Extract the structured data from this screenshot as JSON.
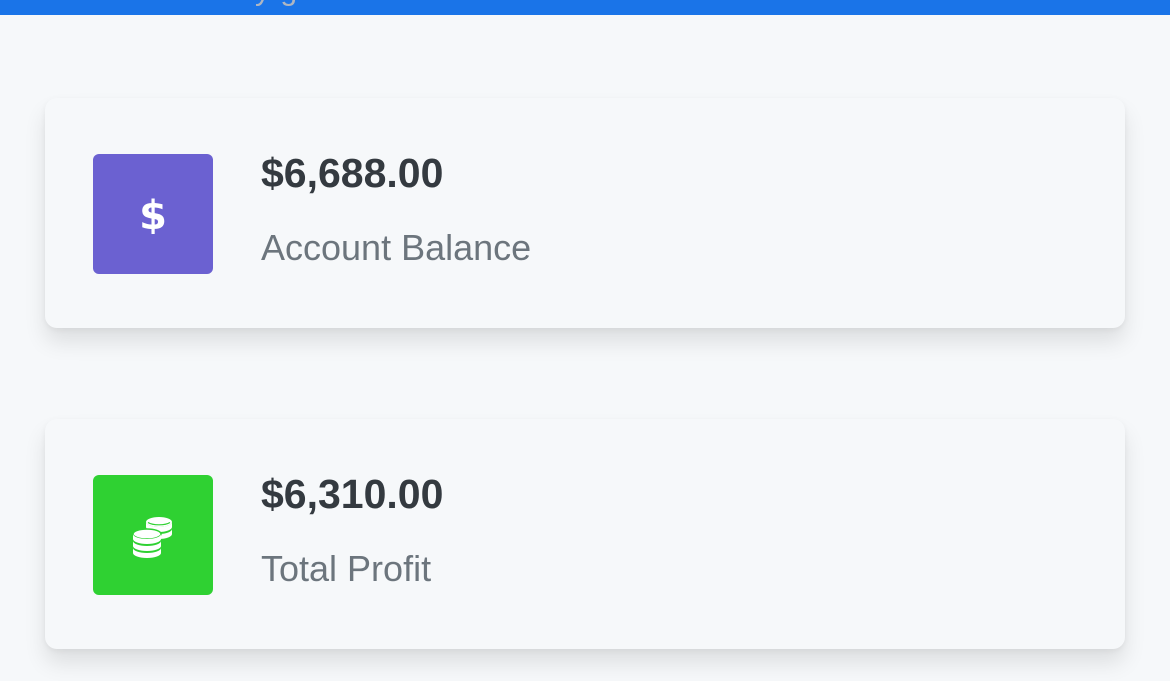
{
  "header": {
    "bar_color": "#1a74e8",
    "partial_heading": "y       g"
  },
  "cards": [
    {
      "value": "$6,688.00",
      "label": "Account Balance",
      "icon": "dollar-sign-icon",
      "color": "#6b61d1"
    },
    {
      "value": "$6,310.00",
      "label": "Total Profit",
      "icon": "coins-icon",
      "color": "#2fd132"
    }
  ]
}
